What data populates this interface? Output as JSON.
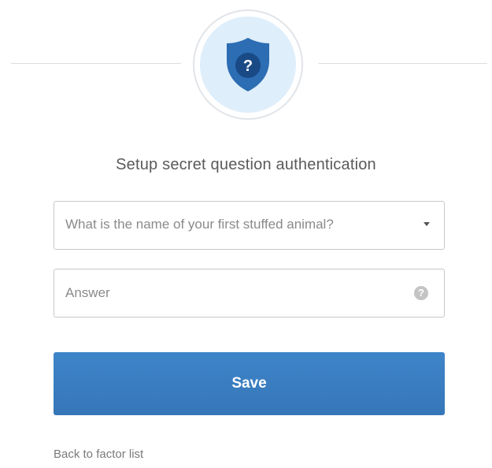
{
  "icon": {
    "name": "shield-question-icon",
    "glyph": "?",
    "colors": {
      "shield": "#2c6db3",
      "shield_inner": "#1a4a86",
      "circle_bg": "#dfeefb"
    }
  },
  "title": "Setup secret question authentication",
  "question_select": {
    "selected_value": "What is the name of your first stuffed animal?"
  },
  "answer": {
    "placeholder": "Answer",
    "value": "",
    "help_glyph": "?"
  },
  "save_button": {
    "label": "Save",
    "color": "#3a7fc4"
  },
  "back_link": {
    "label": "Back to factor list"
  }
}
